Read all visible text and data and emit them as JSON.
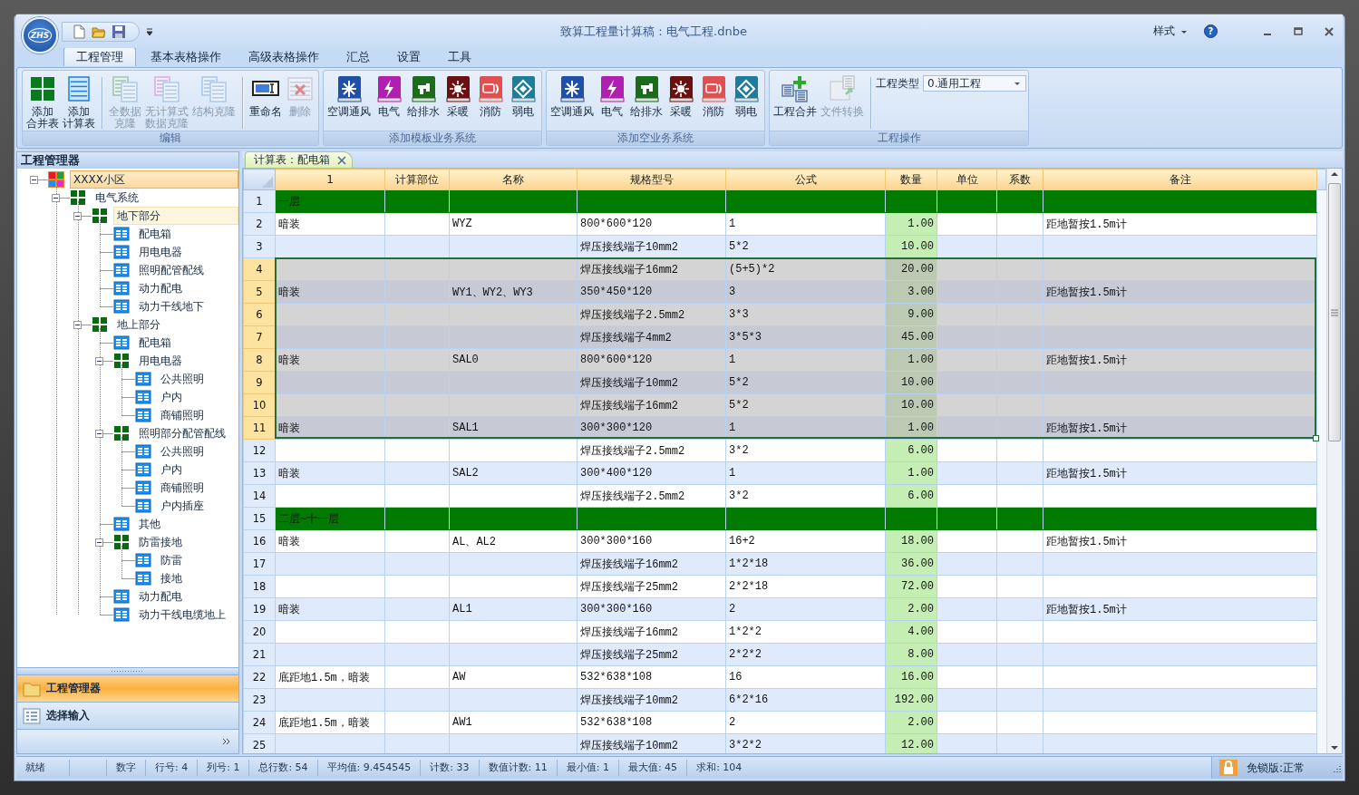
{
  "window": {
    "title": "致算工程量计算稿：电气工程.dnbe",
    "app_button": "ZHS",
    "style_menu": "样式",
    "help_button": "?"
  },
  "ribbon": {
    "tabs": [
      {
        "label": "工程管理",
        "selected": true
      },
      {
        "label": "基本表格操作",
        "selected": false
      },
      {
        "label": "高级表格操作",
        "selected": false
      },
      {
        "label": "汇总",
        "selected": false
      },
      {
        "label": "设置",
        "selected": false
      },
      {
        "label": "工具",
        "selected": false
      }
    ],
    "groups": [
      {
        "label": "编辑",
        "sections": [
          [
            {
              "kind": "merge-table",
              "lines": [
                "添加",
                "合并表"
              ],
              "disabled": false
            },
            {
              "kind": "calc-table",
              "lines": [
                "添加",
                "计算表"
              ],
              "disabled": false
            }
          ],
          [
            {
              "kind": "clone-all",
              "lines": [
                "全数据",
                "克隆"
              ],
              "disabled": true
            },
            {
              "kind": "clone-nocalc",
              "lines": [
                "无计算式",
                "数据克隆"
              ],
              "disabled": true
            },
            {
              "kind": "clone-structure",
              "lines": [
                "结构克隆"
              ],
              "disabled": true
            }
          ],
          [
            {
              "kind": "rename",
              "lines": [
                "重命名"
              ],
              "disabled": false
            },
            {
              "kind": "delete",
              "lines": [
                "删除"
              ],
              "disabled": true
            }
          ]
        ]
      },
      {
        "label": "添加模板业务系统",
        "sections": [
          [
            {
              "kind": "hvac",
              "lines": [
                "空调通风"
              ],
              "disabled": false
            },
            {
              "kind": "electric",
              "lines": [
                "电气"
              ],
              "disabled": false
            },
            {
              "kind": "water",
              "lines": [
                "给排水"
              ],
              "disabled": false
            },
            {
              "kind": "heating",
              "lines": [
                "采暖"
              ],
              "disabled": false
            },
            {
              "kind": "fire",
              "lines": [
                "消防"
              ],
              "disabled": false
            },
            {
              "kind": "weak",
              "lines": [
                "弱电"
              ],
              "disabled": false
            }
          ]
        ]
      },
      {
        "label": "添加空业务系统",
        "sections": [
          [
            {
              "kind": "hvac",
              "lines": [
                "空调通风"
              ],
              "disabled": false
            },
            {
              "kind": "electric",
              "lines": [
                "电气"
              ],
              "disabled": false
            },
            {
              "kind": "water",
              "lines": [
                "给排水"
              ],
              "disabled": false
            },
            {
              "kind": "heating",
              "lines": [
                "采暖"
              ],
              "disabled": false
            },
            {
              "kind": "fire",
              "lines": [
                "消防"
              ],
              "disabled": false
            },
            {
              "kind": "weak",
              "lines": [
                "弱电"
              ],
              "disabled": false
            }
          ]
        ]
      },
      {
        "label": "工程操作",
        "sections": [
          [
            {
              "kind": "project-merge",
              "lines": [
                "工程合并"
              ],
              "disabled": false
            },
            {
              "kind": "file-convert",
              "lines": [
                "文件转换"
              ],
              "disabled": true
            }
          ],
          [
            {
              "kind": "combo",
              "label": "工程类型",
              "value": "0.通用工程"
            }
          ]
        ]
      }
    ]
  },
  "sidebar": {
    "title": "工程管理器",
    "tree": [
      {
        "label": "XXXX小区",
        "kind": "project",
        "selected": true,
        "highlighted": false,
        "expanded": true,
        "children": [
          {
            "label": "电气系统",
            "kind": "folder",
            "selected": false,
            "highlighted": false,
            "expanded": true,
            "children": [
              {
                "label": "地下部分",
                "kind": "folder",
                "selected": false,
                "highlighted": true,
                "expanded": true,
                "children": [
                  {
                    "label": "配电箱",
                    "kind": "sheet",
                    "selected": false,
                    "highlighted": false
                  },
                  {
                    "label": "用电电器",
                    "kind": "sheet",
                    "selected": false,
                    "highlighted": false
                  },
                  {
                    "label": "照明配管配线",
                    "kind": "sheet",
                    "selected": false,
                    "highlighted": false
                  },
                  {
                    "label": "动力配电",
                    "kind": "sheet",
                    "selected": false,
                    "highlighted": false
                  },
                  {
                    "label": "动力干线地下",
                    "kind": "sheet",
                    "selected": false,
                    "highlighted": false
                  }
                ]
              },
              {
                "label": "地上部分",
                "kind": "folder",
                "selected": false,
                "highlighted": false,
                "expanded": true,
                "children": [
                  {
                    "label": "配电箱",
                    "kind": "sheet",
                    "selected": false,
                    "highlighted": false
                  },
                  {
                    "label": "用电电器",
                    "kind": "folder",
                    "selected": false,
                    "highlighted": false,
                    "expanded": true,
                    "children": [
                      {
                        "label": "公共照明",
                        "kind": "sheet",
                        "selected": false,
                        "highlighted": false
                      },
                      {
                        "label": "户内",
                        "kind": "sheet",
                        "selected": false,
                        "highlighted": false
                      },
                      {
                        "label": "商铺照明",
                        "kind": "sheet",
                        "selected": false,
                        "highlighted": false
                      }
                    ]
                  },
                  {
                    "label": "照明部分配管配线",
                    "kind": "folder",
                    "selected": false,
                    "highlighted": false,
                    "expanded": true,
                    "children": [
                      {
                        "label": "公共照明",
                        "kind": "sheet",
                        "selected": false,
                        "highlighted": false
                      },
                      {
                        "label": "户内",
                        "kind": "sheet",
                        "selected": false,
                        "highlighted": false
                      },
                      {
                        "label": "商铺照明",
                        "kind": "sheet",
                        "selected": false,
                        "highlighted": false
                      },
                      {
                        "label": "户内插座",
                        "kind": "sheet",
                        "selected": false,
                        "highlighted": false
                      }
                    ]
                  },
                  {
                    "label": "其他",
                    "kind": "sheet",
                    "selected": false,
                    "highlighted": false
                  },
                  {
                    "label": "防雷接地",
                    "kind": "folder",
                    "selected": false,
                    "highlighted": false,
                    "expanded": true,
                    "children": [
                      {
                        "label": "防雷",
                        "kind": "sheet",
                        "selected": false,
                        "highlighted": false
                      },
                      {
                        "label": "接地",
                        "kind": "sheet",
                        "selected": false,
                        "highlighted": false
                      }
                    ]
                  },
                  {
                    "label": "动力配电",
                    "kind": "sheet",
                    "selected": false,
                    "highlighted": false
                  },
                  {
                    "label": "动力干线电缆地上",
                    "kind": "sheet",
                    "selected": false,
                    "highlighted": false
                  }
                ]
              }
            ]
          }
        ]
      }
    ],
    "panes": [
      {
        "label": "工程管理器",
        "kind": "folder",
        "selected": true
      },
      {
        "label": "选择输入",
        "kind": "input",
        "selected": false
      }
    ]
  },
  "sheet_tab": {
    "label": "计算表：配电箱",
    "selected": true
  },
  "table": {
    "columns": [
      {
        "label": "1",
        "kind": "text"
      },
      {
        "label": "计算部位",
        "kind": "text"
      },
      {
        "label": "名称",
        "kind": "text"
      },
      {
        "label": "规格型号",
        "kind": "text"
      },
      {
        "label": "公式",
        "kind": "text"
      },
      {
        "label": "数量",
        "kind": "quantity"
      },
      {
        "label": "单位",
        "kind": "text"
      },
      {
        "label": "系数",
        "kind": "text"
      },
      {
        "label": "备注",
        "kind": "text"
      }
    ],
    "rows": [
      {
        "number": "1",
        "kind": "group",
        "selected": false,
        "cells": [
          "一层",
          null,
          null,
          null,
          null,
          null,
          null,
          null,
          null
        ]
      },
      {
        "number": "2",
        "kind": "data",
        "selected": false,
        "cells": [
          "暗装",
          null,
          "WYZ",
          "800*600*120",
          "1",
          "1.00",
          null,
          null,
          "距地暂按1.5m计"
        ]
      },
      {
        "number": "3",
        "kind": "data",
        "selected": false,
        "cells": [
          null,
          null,
          null,
          "焊压接线端子10mm2",
          "5*2",
          "10.00",
          null,
          null,
          null
        ]
      },
      {
        "number": "4",
        "kind": "data",
        "selected": true,
        "cells": [
          null,
          null,
          null,
          "焊压接线端子16mm2",
          "(5+5)*2",
          "20.00",
          null,
          null,
          null
        ]
      },
      {
        "number": "5",
        "kind": "data",
        "selected": true,
        "cells": [
          "暗装",
          null,
          "WY1、WY2、WY3",
          "350*450*120",
          "3",
          "3.00",
          null,
          null,
          "距地暂按1.5m计"
        ]
      },
      {
        "number": "6",
        "kind": "data",
        "selected": true,
        "cells": [
          null,
          null,
          null,
          "焊压接线端子2.5mm2",
          "3*3",
          "9.00",
          null,
          null,
          null
        ]
      },
      {
        "number": "7",
        "kind": "data",
        "selected": true,
        "cells": [
          null,
          null,
          null,
          "焊压接线端子4mm2",
          "3*5*3",
          "45.00",
          null,
          null,
          null
        ]
      },
      {
        "number": "8",
        "kind": "data",
        "selected": true,
        "cells": [
          "暗装",
          null,
          "SAL0",
          "800*600*120",
          "1",
          "1.00",
          null,
          null,
          "距地暂按1.5m计"
        ]
      },
      {
        "number": "9",
        "kind": "data",
        "selected": true,
        "cells": [
          null,
          null,
          null,
          "焊压接线端子10mm2",
          "5*2",
          "10.00",
          null,
          null,
          null
        ]
      },
      {
        "number": "10",
        "kind": "data",
        "selected": true,
        "cells": [
          null,
          null,
          null,
          "焊压接线端子16mm2",
          "5*2",
          "10.00",
          null,
          null,
          null
        ]
      },
      {
        "number": "11",
        "kind": "data",
        "selected": true,
        "cells": [
          "暗装",
          null,
          "SAL1",
          "300*300*120",
          "1",
          "1.00",
          null,
          null,
          "距地暂按1.5m计"
        ]
      },
      {
        "number": "12",
        "kind": "data",
        "selected": false,
        "cells": [
          null,
          null,
          null,
          "焊压接线端子2.5mm2",
          "3*2",
          "6.00",
          null,
          null,
          null
        ]
      },
      {
        "number": "13",
        "kind": "data",
        "selected": false,
        "cells": [
          "暗装",
          null,
          "SAL2",
          "300*400*120",
          "1",
          "1.00",
          null,
          null,
          "距地暂按1.5m计"
        ]
      },
      {
        "number": "14",
        "kind": "data",
        "selected": false,
        "cells": [
          null,
          null,
          null,
          "焊压接线端子2.5mm2",
          "3*2",
          "6.00",
          null,
          null,
          null
        ]
      },
      {
        "number": "15",
        "kind": "group",
        "selected": false,
        "cells": [
          "二层~十一层",
          null,
          null,
          null,
          null,
          null,
          null,
          null,
          null
        ]
      },
      {
        "number": "16",
        "kind": "data",
        "selected": false,
        "cells": [
          "暗装",
          null,
          "AL、AL2",
          "300*300*160",
          "16+2",
          "18.00",
          null,
          null,
          "距地暂按1.5m计"
        ]
      },
      {
        "number": "17",
        "kind": "data",
        "selected": false,
        "cells": [
          null,
          null,
          null,
          "焊压接线端子16mm2",
          "1*2*18",
          "36.00",
          null,
          null,
          null
        ]
      },
      {
        "number": "18",
        "kind": "data",
        "selected": false,
        "cells": [
          null,
          null,
          null,
          "焊压接线端子25mm2",
          "2*2*18",
          "72.00",
          null,
          null,
          null
        ]
      },
      {
        "number": "19",
        "kind": "data",
        "selected": false,
        "cells": [
          "暗装",
          null,
          "AL1",
          "300*300*160",
          "2",
          "2.00",
          null,
          null,
          "距地暂按1.5m计"
        ]
      },
      {
        "number": "20",
        "kind": "data",
        "selected": false,
        "cells": [
          null,
          null,
          null,
          "焊压接线端子16mm2",
          "1*2*2",
          "4.00",
          null,
          null,
          null
        ]
      },
      {
        "number": "21",
        "kind": "data",
        "selected": false,
        "cells": [
          null,
          null,
          null,
          "焊压接线端子25mm2",
          "2*2*2",
          "8.00",
          null,
          null,
          null
        ]
      },
      {
        "number": "22",
        "kind": "data",
        "selected": false,
        "cells": [
          "底距地1.5m，暗装",
          null,
          "AW",
          "532*638*108",
          "16",
          "16.00",
          null,
          null,
          null
        ]
      },
      {
        "number": "23",
        "kind": "data",
        "selected": false,
        "cells": [
          null,
          null,
          null,
          "焊压接线端子10mm2",
          "6*2*16",
          "192.00",
          null,
          null,
          null
        ]
      },
      {
        "number": "24",
        "kind": "data",
        "selected": false,
        "cells": [
          "底距地1.5m，暗装",
          null,
          "AW1",
          "532*638*108",
          "2",
          "2.00",
          null,
          null,
          null
        ]
      },
      {
        "number": "25",
        "kind": "data",
        "selected": false,
        "cells": [
          null,
          null,
          null,
          "焊压接线端子10mm2",
          "3*2*2",
          "12.00",
          null,
          null,
          null
        ]
      }
    ]
  },
  "status_bar": {
    "items": [
      "就绪",
      "数字",
      "行号: 4",
      "列号: 1",
      "总行数: 54",
      "平均值: 9.454545",
      "计数: 33",
      "数值计数: 11",
      "最小值: 1",
      "最大值: 45",
      "求和: 104"
    ],
    "license": "免锁版:正常"
  }
}
